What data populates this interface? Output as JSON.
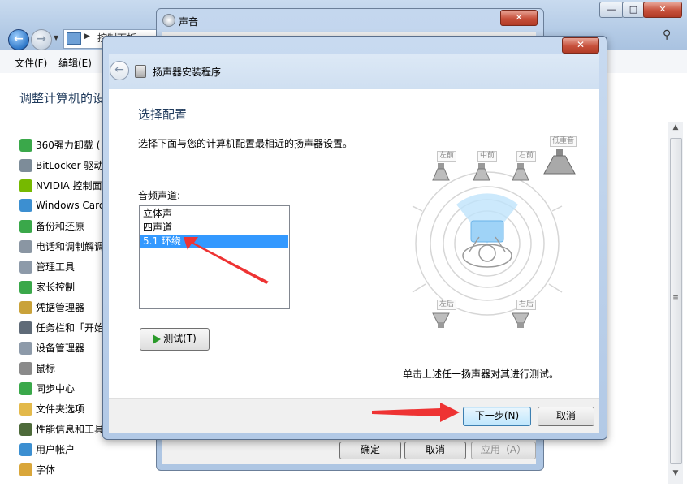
{
  "control_panel": {
    "address_text": "控制面板",
    "menu": [
      "文件(F)",
      "编辑(E)"
    ],
    "heading": "调整计算机的设",
    "items": [
      {
        "label": "360强力卸载 (",
        "icon": "uninstall-icon",
        "color": "#3aa84a"
      },
      {
        "label": "BitLocker 驱动",
        "icon": "bitlocker-icon",
        "color": "#7d8c99"
      },
      {
        "label": "NVIDIA 控制面",
        "icon": "nvidia-icon",
        "color": "#76b900"
      },
      {
        "label": "Windows Card",
        "icon": "cardspace-icon",
        "color": "#3c8fd1"
      },
      {
        "label": "备份和还原",
        "icon": "backup-icon",
        "color": "#3aa84a"
      },
      {
        "label": "电话和调制解调",
        "icon": "phone-icon",
        "color": "#8a96a3"
      },
      {
        "label": "管理工具",
        "icon": "admin-tools-icon",
        "color": "#8d9aa9"
      },
      {
        "label": "家长控制",
        "icon": "parental-control-icon",
        "color": "#3aa84a"
      },
      {
        "label": "凭据管理器",
        "icon": "credential-icon",
        "color": "#c9a23a"
      },
      {
        "label": "任务栏和「开始",
        "icon": "taskbar-icon",
        "color": "#5f6b78"
      },
      {
        "label": "设备管理器",
        "icon": "device-manager-icon",
        "color": "#8d9aa9"
      },
      {
        "label": "鼠标",
        "icon": "mouse-icon",
        "color": "#8a8a8a"
      },
      {
        "label": "同步中心",
        "icon": "sync-icon",
        "color": "#3aa84a"
      },
      {
        "label": "文件夹选项",
        "icon": "folder-icon",
        "color": "#e3b94a"
      },
      {
        "label": "性能信息和工具",
        "icon": "performance-icon",
        "color": "#4d6a3a"
      },
      {
        "label": "用户帐户",
        "icon": "users-icon",
        "color": "#3c8fd1"
      },
      {
        "label": "字体",
        "icon": "font-icon",
        "color": "#d9a63a"
      }
    ]
  },
  "sound_dialog": {
    "title": "声音",
    "buttons": {
      "ok": "确定",
      "cancel": "取消",
      "apply": "应用（A）"
    }
  },
  "wizard": {
    "title": "扬声器安装程序",
    "heading": "选择配置",
    "description": "选择下面与您的计算机配置最相近的扬声器设置。",
    "channels_label": "音频声道:",
    "channels": [
      "立体声",
      "四声道",
      "5.1 环绕"
    ],
    "selected_channel": "5.1 环绕",
    "test_button": "测试(T)",
    "speaker_labels": {
      "front_left": "左前",
      "center": "中前",
      "front_right": "右前",
      "subwoofer": "低重音",
      "rear_left": "左后",
      "rear_right": "右后"
    },
    "hint": "单击上述任一扬声器对其进行测试。",
    "next_button": "下一步(N)",
    "cancel_button": "取消"
  },
  "colors": {
    "selection": "#3399ff",
    "annotation_arrow": "#ee3333",
    "heading": "#1e395b"
  }
}
